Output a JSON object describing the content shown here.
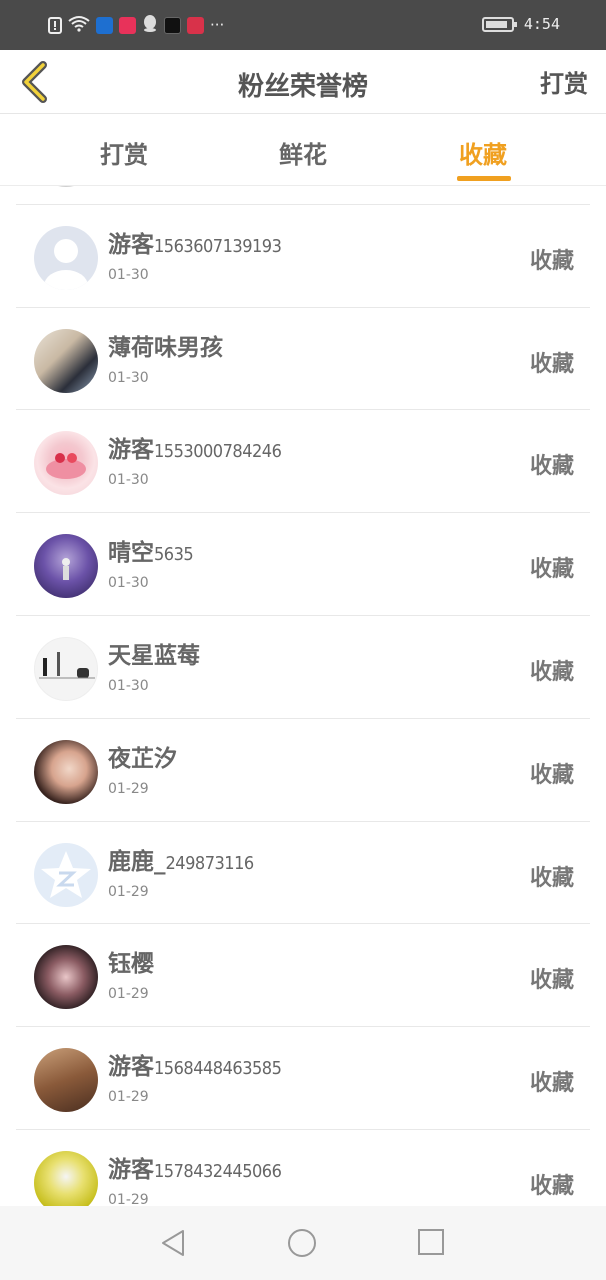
{
  "status_bar": {
    "time": "4:54",
    "icons": [
      "alert-icon",
      "wifi-icon",
      "shield-app-icon",
      "video-app-icon",
      "qq-icon",
      "tiktok-icon",
      "calendar-app-icon"
    ],
    "more": "···"
  },
  "header": {
    "title": "粉丝荣誉榜",
    "action_label": "打赏"
  },
  "tabs": [
    {
      "label": "打赏",
      "active": false
    },
    {
      "label": "鲜花",
      "active": false
    },
    {
      "label": "收藏",
      "active": true
    }
  ],
  "accent_color": "#f0a020",
  "list": [
    {
      "name": "游客",
      "suffix": "1563607139193",
      "date": "01-30",
      "action": "收藏",
      "avatar": "default-person"
    },
    {
      "name": "薄荷味男孩",
      "suffix": "",
      "date": "01-30",
      "action": "收藏",
      "avatar": "photo"
    },
    {
      "name": "游客",
      "suffix": "1553000784246",
      "date": "01-30",
      "action": "收藏",
      "avatar": "cake"
    },
    {
      "name": "晴空",
      "suffix": "5635",
      "date": "01-30",
      "action": "收藏",
      "avatar": "photo-purple"
    },
    {
      "name": "天星蓝莓",
      "suffix": "",
      "date": "01-30",
      "action": "收藏",
      "avatar": "sketch"
    },
    {
      "name": "夜芷汐",
      "suffix": "",
      "date": "01-29",
      "action": "收藏",
      "avatar": "photo"
    },
    {
      "name": "鹿鹿_",
      "suffix": "249873116",
      "date": "01-29",
      "action": "收藏",
      "avatar": "qzone-star"
    },
    {
      "name": "钰樱",
      "suffix": "",
      "date": "01-29",
      "action": "收藏",
      "avatar": "photo-dark"
    },
    {
      "name": "游客",
      "suffix": "1568448463585",
      "date": "01-29",
      "action": "收藏",
      "avatar": "photo-brown"
    },
    {
      "name": "游客",
      "suffix": "1578432445066",
      "date": "01-29",
      "action": "收藏",
      "avatar": "photo-yellow"
    }
  ],
  "bottom_nav": [
    "back-triangle-icon",
    "home-circle-icon",
    "recents-square-icon"
  ]
}
